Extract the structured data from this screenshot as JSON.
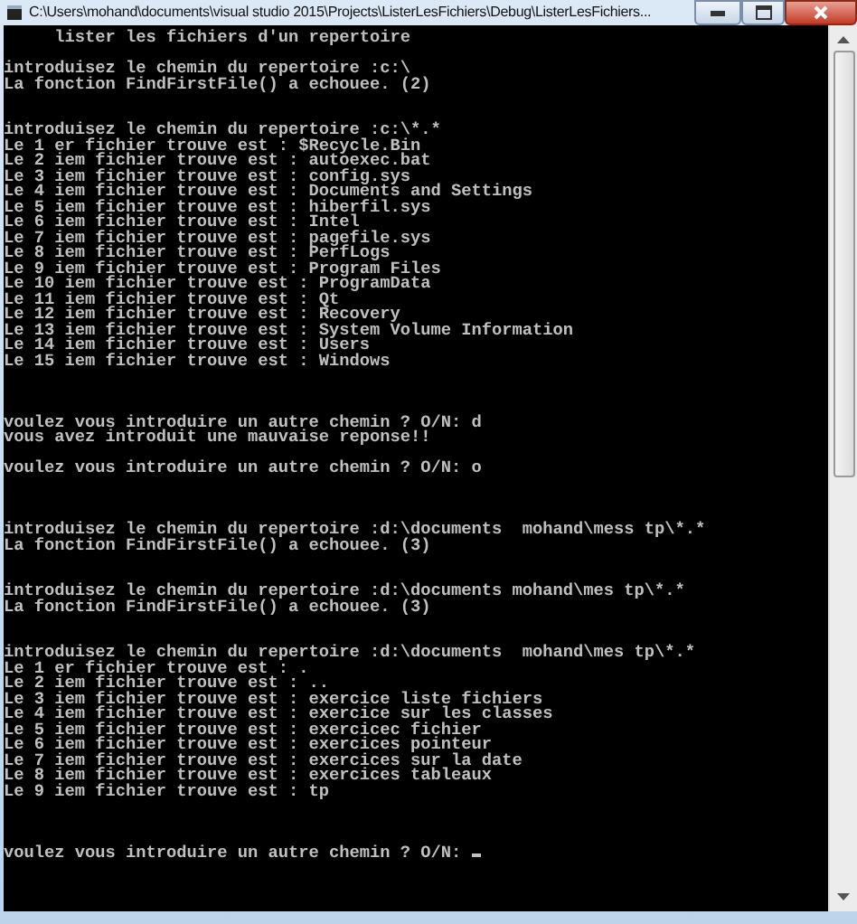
{
  "window": {
    "title": "C:\\Users\\mohand\\documents\\visual studio 2015\\Projects\\ListerLesFichiers\\Debug\\ListerLesFichiers..."
  },
  "console": {
    "lines": [
      {
        "kind": "text",
        "text": "     lister les fichiers d'un repertoire"
      },
      {
        "kind": "blank"
      },
      {
        "kind": "text",
        "text": "introduisez le chemin du repertoire :c:\\"
      },
      {
        "kind": "text",
        "text": "La fonction FindFirstFile() a echouee. (2)"
      },
      {
        "kind": "blank"
      },
      {
        "kind": "blank"
      },
      {
        "kind": "text",
        "text": "introduisez le chemin du repertoire :c:\\*.*"
      },
      {
        "kind": "text",
        "text": "Le 1 er fichier trouve est : $Recycle.Bin"
      },
      {
        "kind": "text",
        "text": "Le 2 iem fichier trouve est : autoexec.bat"
      },
      {
        "kind": "text",
        "text": "Le 3 iem fichier trouve est : config.sys"
      },
      {
        "kind": "text",
        "text": "Le 4 iem fichier trouve est : Documents and Settings"
      },
      {
        "kind": "text",
        "text": "Le 5 iem fichier trouve est : hiberfil.sys"
      },
      {
        "kind": "text",
        "text": "Le 6 iem fichier trouve est : Intel"
      },
      {
        "kind": "text",
        "text": "Le 7 iem fichier trouve est : pagefile.sys"
      },
      {
        "kind": "text",
        "text": "Le 8 iem fichier trouve est : PerfLogs"
      },
      {
        "kind": "text",
        "text": "Le 9 iem fichier trouve est : Program Files"
      },
      {
        "kind": "text",
        "text": "Le 10 iem fichier trouve est : ProgramData"
      },
      {
        "kind": "text",
        "text": "Le 11 iem fichier trouve est : Qt"
      },
      {
        "kind": "text",
        "text": "Le 12 iem fichier trouve est : Recovery"
      },
      {
        "kind": "text",
        "text": "Le 13 iem fichier trouve est : System Volume Information"
      },
      {
        "kind": "text",
        "text": "Le 14 iem fichier trouve est : Users"
      },
      {
        "kind": "text",
        "text": "Le 15 iem fichier trouve est : Windows"
      },
      {
        "kind": "blank"
      },
      {
        "kind": "blank"
      },
      {
        "kind": "blank"
      },
      {
        "kind": "text",
        "text": "voulez vous introduire un autre chemin ? O/N: d"
      },
      {
        "kind": "text",
        "text": "vous avez introduit une mauvaise reponse!!"
      },
      {
        "kind": "blank"
      },
      {
        "kind": "text",
        "text": "voulez vous introduire un autre chemin ? O/N: o"
      },
      {
        "kind": "blank"
      },
      {
        "kind": "blank"
      },
      {
        "kind": "blank"
      },
      {
        "kind": "text",
        "text": "introduisez le chemin du repertoire :d:\\documents  mohand\\mess tp\\*.*"
      },
      {
        "kind": "text",
        "text": "La fonction FindFirstFile() a echouee. (3)"
      },
      {
        "kind": "blank"
      },
      {
        "kind": "blank"
      },
      {
        "kind": "text",
        "text": "introduisez le chemin du repertoire :d:\\documents mohand\\mes tp\\*.*"
      },
      {
        "kind": "text",
        "text": "La fonction FindFirstFile() a echouee. (3)"
      },
      {
        "kind": "blank"
      },
      {
        "kind": "blank"
      },
      {
        "kind": "text",
        "text": "introduisez le chemin du repertoire :d:\\documents  mohand\\mes tp\\*.*"
      },
      {
        "kind": "text",
        "text": "Le 1 er fichier trouve est : ."
      },
      {
        "kind": "text",
        "text": "Le 2 iem fichier trouve est : .."
      },
      {
        "kind": "text",
        "text": "Le 3 iem fichier trouve est : exercice liste fichiers"
      },
      {
        "kind": "text",
        "text": "Le 4 iem fichier trouve est : exercice sur les classes"
      },
      {
        "kind": "text",
        "text": "Le 5 iem fichier trouve est : exercicec fichier"
      },
      {
        "kind": "text",
        "text": "Le 6 iem fichier trouve est : exercices pointeur"
      },
      {
        "kind": "text",
        "text": "Le 7 iem fichier trouve est : exercices sur la date"
      },
      {
        "kind": "text",
        "text": "Le 8 iem fichier trouve est : exercices tableaux"
      },
      {
        "kind": "text",
        "text": "Le 9 iem fichier trouve est : tp"
      },
      {
        "kind": "blank"
      },
      {
        "kind": "blank"
      },
      {
        "kind": "blank"
      },
      {
        "kind": "prompt",
        "text": "voulez vous introduire un autre chemin ? O/N: ",
        "cursor": true
      }
    ]
  }
}
